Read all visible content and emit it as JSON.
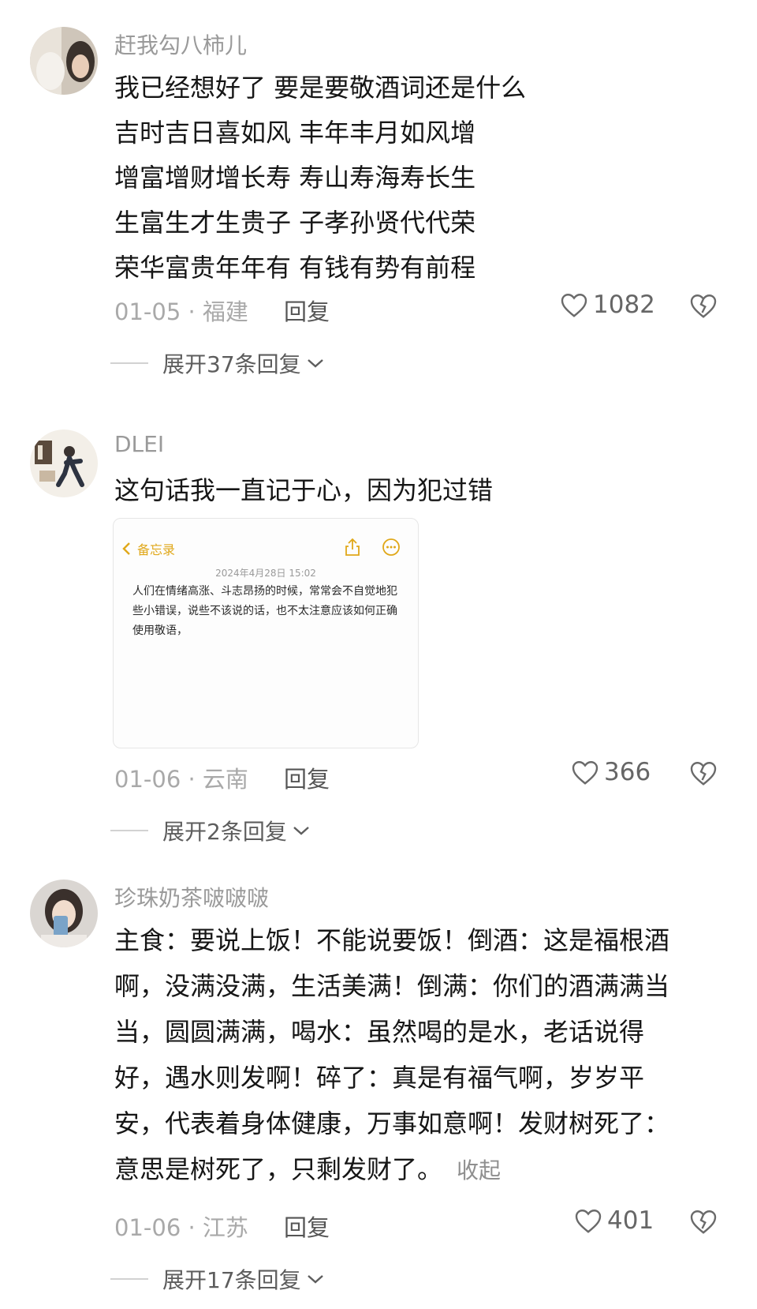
{
  "comments": [
    {
      "username": "赶我勾八柿儿",
      "lines": [
        "我已经想好了 要是要敬酒词还是什么",
        "吉时吉日喜如风 丰年丰月如风增",
        "增富增财增长寿 寿山寿海寿长生",
        "生富生才生贵子 子孝孙贤代代荣",
        "荣华富贵年年有 有钱有势有前程"
      ],
      "date_location": "01-05 · 福建",
      "reply_label": "回复",
      "likes": "1082",
      "expand_label": "展开37条回复"
    },
    {
      "username": "DLEI",
      "lines": [
        "这句话我一直记于心，因为犯过错"
      ],
      "memo": {
        "back_label": "备忘录",
        "date": "2024年4月28日 15:02",
        "text": "人们在情绪高涨、斗志昂扬的时候，常常会不自觉地犯些小错误，说些不该说的话，也不太注意应该如何正确使用敬语，"
      },
      "date_location": "01-06 · 云南",
      "reply_label": "回复",
      "likes": "366",
      "expand_label": "展开2条回复"
    },
    {
      "username": "珍珠奶茶啵啵啵",
      "lines": [
        "主食：要说上饭！不能说要饭！倒酒：这是福根酒",
        "啊，没满没满，生活美满！倒满：你们的酒满满当",
        "当，圆圆满满，喝水：虽然喝的是水，老话说得",
        "好，遇水则发啊！碎了：真是有福气啊，岁岁平",
        "安，代表着身体健康，万事如意啊！发财树死了：",
        "意思是树死了，只剩发财了。"
      ],
      "collapse_label": "收起",
      "date_location": "01-06 · 江苏",
      "reply_label": "回复",
      "likes": "401",
      "expand_label": "展开17条回复"
    }
  ],
  "colors": {
    "text": "#161616",
    "meta": "#a9a9a9",
    "memo_accent": "#e0a81a"
  },
  "icons": [
    "heart-icon",
    "broken-heart-icon",
    "chevron-down-icon",
    "chevron-left-icon",
    "share-icon",
    "more-icon"
  ]
}
